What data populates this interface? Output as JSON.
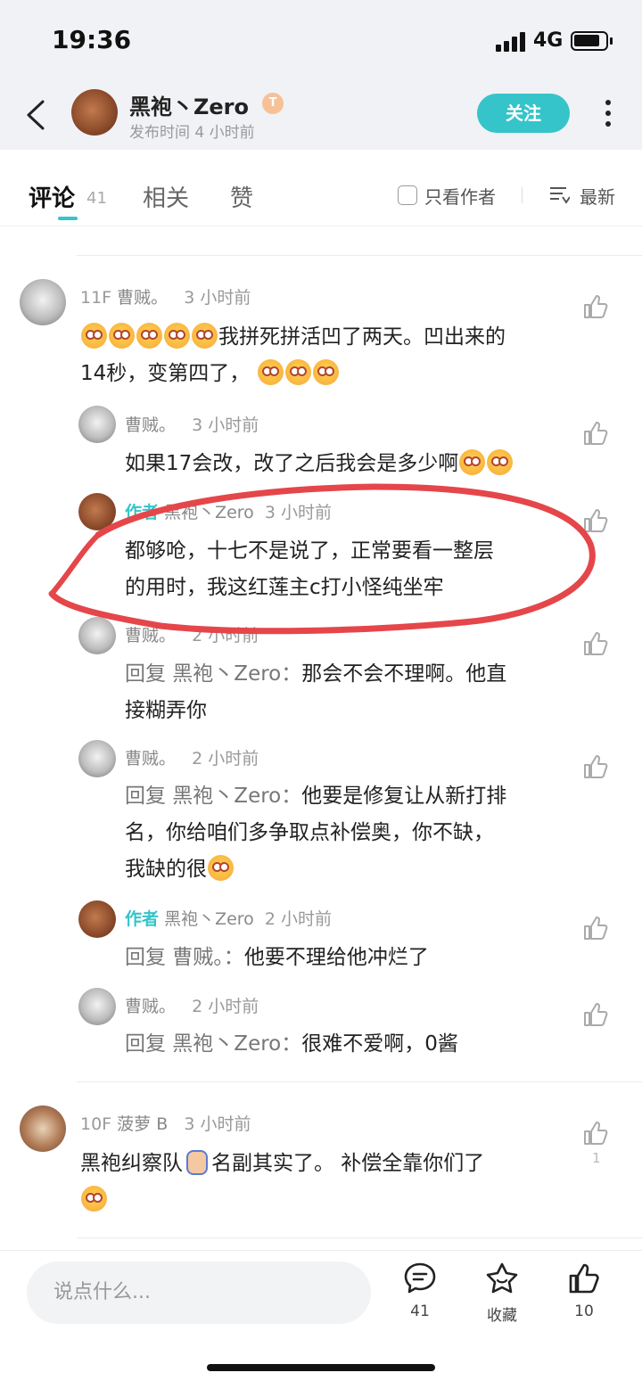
{
  "status_bar": {
    "time": "19:36",
    "network": "4G"
  },
  "header": {
    "author_name": "黑袍丶Zero",
    "author_badge": "T",
    "publish_time": "发布时间 4 小时前",
    "follow_label": "关注"
  },
  "tabs": {
    "comments_label": "评论",
    "comments_count": "41",
    "related_label": "相关",
    "likes_label": "赞",
    "only_author_label": "只看作者",
    "sort_label": "最新"
  },
  "comments": [
    {
      "floor": "11F",
      "user": "曹贼。",
      "time": "3 小时前",
      "text": "我拼死拼活凹了两天。凹出来的",
      "text_line2": "14秒，变第四了，",
      "replies": [
        {
          "author_tag": "",
          "user": "曹贼。",
          "time": "3 小时前",
          "reply_to": "",
          "text": "如果17会改，改了之后我会是多少啊"
        },
        {
          "author_tag": "作者",
          "user": "黑袍丶Zero",
          "time": "3 小时前",
          "reply_to": "",
          "text": "都够呛，十七不是说了，正常要看一整层",
          "text_line2": "的用时，我这红莲主c打小怪纯坐牢"
        },
        {
          "author_tag": "",
          "user": "曹贼。",
          "time": "2 小时前",
          "reply_to": "回复 黑袍丶Zero：",
          "text": "那会不会不理啊。他直",
          "text_line2": "接糊弄你"
        },
        {
          "author_tag": "",
          "user": "曹贼。",
          "time": "2 小时前",
          "reply_to": "回复 黑袍丶Zero：",
          "text": "他要是修复让从新打排",
          "text_line2": "名，你给咱们多争取点补偿奥，你不缺，",
          "text_line3": "我缺的很"
        },
        {
          "author_tag": "作者",
          "user": "黑袍丶Zero",
          "time": "2 小时前",
          "reply_to": "回复 曹贼。：",
          "text": "他要不理给他冲烂了"
        },
        {
          "author_tag": "",
          "user": "曹贼。",
          "time": "2 小时前",
          "reply_to": "回复 黑袍丶Zero：",
          "text": "很难不爱啊，0酱"
        }
      ]
    },
    {
      "floor": "10F",
      "user": "菠萝 B",
      "time": "3 小时前",
      "text_a": "黑袍纠察队",
      "text_b": "名副其实了。 补偿全靠你们了",
      "like_count": "1"
    }
  ],
  "bottom_bar": {
    "input_placeholder": "说点什么...",
    "comment_count": "41",
    "favorite_label": "收藏",
    "like_count": "10"
  },
  "colors": {
    "accent": "#35c4c9",
    "annotation": "#e5464a"
  }
}
